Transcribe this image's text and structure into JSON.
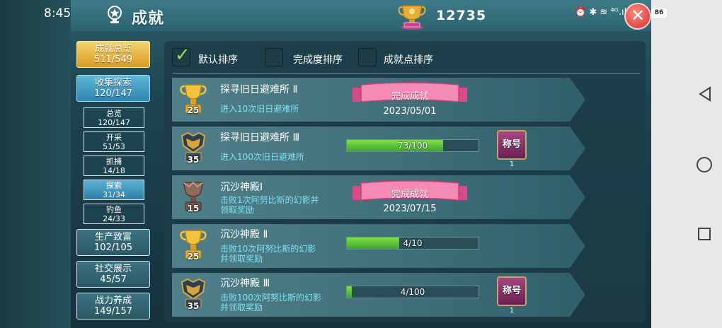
{
  "status": {
    "time": "8:45",
    "icons": "⏰ ✱ ≋ ⁴ᴳ.ıl ⁴ᴳ.ıl",
    "battery": "86"
  },
  "header": {
    "title": "成就",
    "score": "12735",
    "title_icon": "trophy-icon",
    "score_icon": "trophy-icon",
    "close_icon": "close-icon"
  },
  "sidebar": {
    "total": {
      "label": "成就总览",
      "value": "511/549"
    },
    "collect": {
      "label": "收集探索",
      "value": "120/147"
    },
    "sub": [
      {
        "label": "总览",
        "value": "120/147"
      },
      {
        "label": "开采",
        "value": "51/53"
      },
      {
        "label": "抓捕",
        "value": "14/18"
      },
      {
        "label": "探索",
        "value": "31/34"
      },
      {
        "label": "钓鱼",
        "value": "24/33"
      }
    ],
    "categories": [
      {
        "label": "生产致富",
        "value": "102/105"
      },
      {
        "label": "社交展示",
        "value": "45/57"
      },
      {
        "label": "战力养成",
        "value": "149/157"
      }
    ]
  },
  "sort": {
    "default": "默认排序",
    "completion": "完成度排序",
    "points": "成就点排序",
    "checked": "default"
  },
  "achievements": [
    {
      "name": "探寻旧日避难所 Ⅱ",
      "desc1": "进入10次旧日避难所",
      "desc2": "",
      "points": "25",
      "trophy": "gold",
      "done": true,
      "ribbon": "完成成就",
      "date": "2023/05/01"
    },
    {
      "name": "探寻旧日避难所 Ⅲ",
      "desc1": "进入100次旧日避难所",
      "desc2": "",
      "points": "35",
      "trophy": "armor",
      "done": false,
      "progress": "73/100",
      "fraction": 0.73,
      "badge": "称号",
      "badge_count": "1"
    },
    {
      "name": "沉沙神殿Ⅰ",
      "desc1": "击败1次阿努比斯的幻影并",
      "desc2": "领取奖励",
      "points": "15",
      "trophy": "bronze",
      "done": true,
      "ribbon": "完成成就",
      "date": "2023/07/15"
    },
    {
      "name": "沉沙神殿 Ⅱ",
      "desc1": "击败10次阿努比斯的幻影",
      "desc2": "并领取奖励",
      "points": "25",
      "trophy": "gold",
      "done": false,
      "progress": "4/10",
      "fraction": 0.4
    },
    {
      "name": "沉沙神殿 Ⅲ",
      "desc1": "击败100次阿努比斯的幻影",
      "desc2": "并领取奖励",
      "points": "35",
      "trophy": "armor",
      "done": false,
      "progress": "4/100",
      "fraction": 0.04,
      "badge": "称号",
      "badge_count": "1"
    }
  ],
  "colors": {
    "gold": "#e2a530",
    "progress_green": "#5fc93a",
    "desc_cyan": "#7fe0f0"
  }
}
